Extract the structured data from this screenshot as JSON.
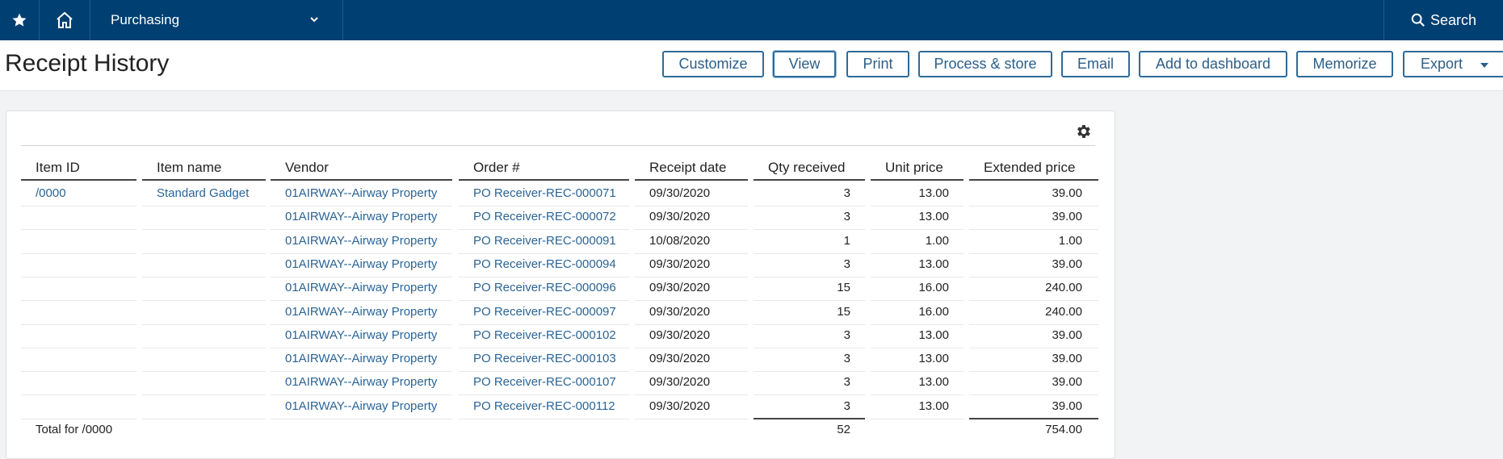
{
  "topbar": {
    "app_name": "Purchasing",
    "search_label": "Search"
  },
  "page": {
    "title": "Receipt History"
  },
  "toolbar": {
    "customize": "Customize",
    "view": "View",
    "print": "Print",
    "process_store": "Process & store",
    "email": "Email",
    "add_to_dashboard": "Add to dashboard",
    "memorize": "Memorize",
    "export": "Export"
  },
  "table": {
    "columns": [
      "Item ID",
      "Item name",
      "Vendor",
      "Order #",
      "Receipt date",
      "Qty received",
      "Unit price",
      "Extended price"
    ],
    "rows": [
      {
        "item_id": "/0000",
        "item_name": "Standard Gadget",
        "vendor": "01AIRWAY--Airway Property",
        "order": "PO Receiver-REC-000071",
        "date": "09/30/2020",
        "qty": "3",
        "unit": "13.00",
        "ext": "39.00"
      },
      {
        "item_id": "",
        "item_name": "",
        "vendor": "01AIRWAY--Airway Property",
        "order": "PO Receiver-REC-000072",
        "date": "09/30/2020",
        "qty": "3",
        "unit": "13.00",
        "ext": "39.00"
      },
      {
        "item_id": "",
        "item_name": "",
        "vendor": "01AIRWAY--Airway Property",
        "order": "PO Receiver-REC-000091",
        "date": "10/08/2020",
        "qty": "1",
        "unit": "1.00",
        "ext": "1.00"
      },
      {
        "item_id": "",
        "item_name": "",
        "vendor": "01AIRWAY--Airway Property",
        "order": "PO Receiver-REC-000094",
        "date": "09/30/2020",
        "qty": "3",
        "unit": "13.00",
        "ext": "39.00"
      },
      {
        "item_id": "",
        "item_name": "",
        "vendor": "01AIRWAY--Airway Property",
        "order": "PO Receiver-REC-000096",
        "date": "09/30/2020",
        "qty": "15",
        "unit": "16.00",
        "ext": "240.00"
      },
      {
        "item_id": "",
        "item_name": "",
        "vendor": "01AIRWAY--Airway Property",
        "order": "PO Receiver-REC-000097",
        "date": "09/30/2020",
        "qty": "15",
        "unit": "16.00",
        "ext": "240.00"
      },
      {
        "item_id": "",
        "item_name": "",
        "vendor": "01AIRWAY--Airway Property",
        "order": "PO Receiver-REC-000102",
        "date": "09/30/2020",
        "qty": "3",
        "unit": "13.00",
        "ext": "39.00"
      },
      {
        "item_id": "",
        "item_name": "",
        "vendor": "01AIRWAY--Airway Property",
        "order": "PO Receiver-REC-000103",
        "date": "09/30/2020",
        "qty": "3",
        "unit": "13.00",
        "ext": "39.00"
      },
      {
        "item_id": "",
        "item_name": "",
        "vendor": "01AIRWAY--Airway Property",
        "order": "PO Receiver-REC-000107",
        "date": "09/30/2020",
        "qty": "3",
        "unit": "13.00",
        "ext": "39.00"
      },
      {
        "item_id": "",
        "item_name": "",
        "vendor": "01AIRWAY--Airway Property",
        "order": "PO Receiver-REC-000112",
        "date": "09/30/2020",
        "qty": "3",
        "unit": "13.00",
        "ext": "39.00"
      }
    ],
    "total": {
      "label": "Total for /0000",
      "qty": "52",
      "ext": "754.00"
    }
  },
  "colors": {
    "topbar": "#003f72",
    "link": "#2a6496",
    "button_border": "#2d6b9b"
  },
  "icons": [
    "star-icon",
    "home-icon",
    "chevron-down-icon",
    "search-icon",
    "gear-icon"
  ]
}
